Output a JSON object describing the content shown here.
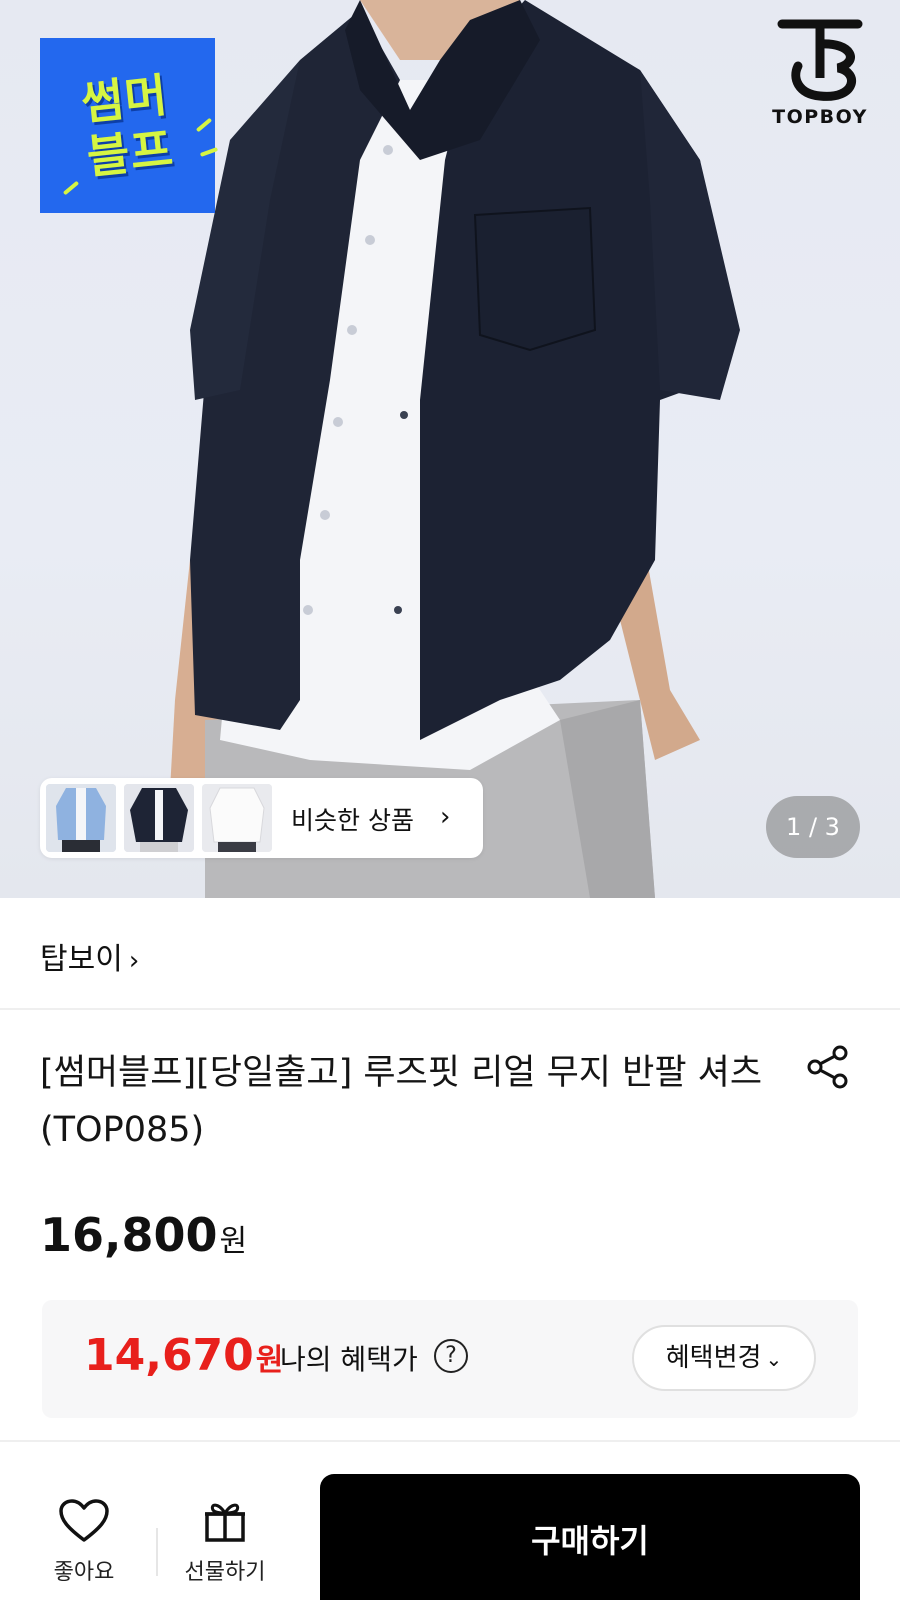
{
  "hero": {
    "promo_badge_text": "썸머\n블프",
    "brand_wordmark": "TOPBOY",
    "similar_label": "비슷한 상품",
    "page_indicator": "1 / 3"
  },
  "product": {
    "brand_name": "탑보이",
    "title": "[썸머블프][당일출고] 루즈핏 리얼 무지 반팔 셔츠 (TOP085)",
    "price": "16,800",
    "price_unit": "원"
  },
  "benefit": {
    "price": "14,670",
    "unit": "원",
    "label": "나의 혜택가",
    "help_icon": "?",
    "change_label": "혜택변경"
  },
  "bottom_bar": {
    "like_label": "좋아요",
    "gift_label": "선물하기",
    "buy_label": "구매하기"
  },
  "colors": {
    "sale_red": "#e8201c",
    "promo_blue": "#2368ee",
    "promo_lime": "#d6f542",
    "shirt_navy": "#1c2233"
  },
  "icons": [
    "chevron-right-icon",
    "share-icon",
    "help-icon",
    "chevron-down-icon",
    "heart-icon",
    "gift-icon"
  ]
}
